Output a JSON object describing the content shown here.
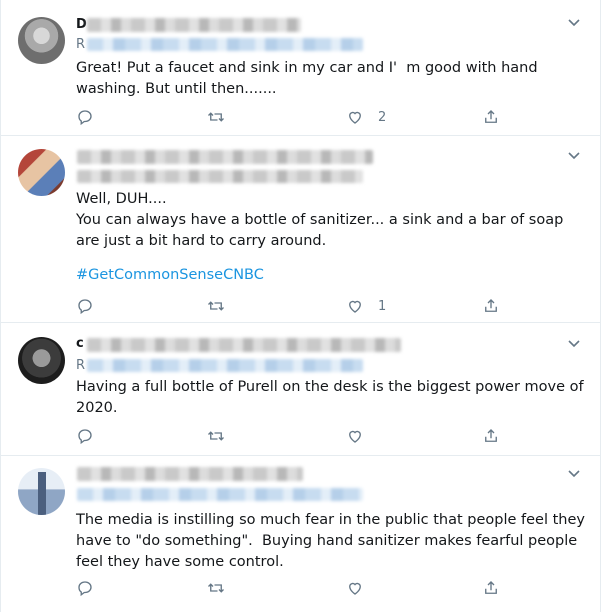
{
  "tweets": [
    {
      "avatar": "user-avatar",
      "initial_1": "D",
      "initial_2": "R",
      "text": "Great! Put a faucet and sink in my car and I'  m good with hand washing. But until then.......",
      "hashtag": "",
      "like_count": "2"
    },
    {
      "avatar": "user-avatar",
      "initial_1": "",
      "initial_2": "",
      "text": "Well, DUH....\nYou can always have a bottle of sanitizer... a sink and a bar of soap are just a bit hard to carry around.",
      "hashtag": "#GetCommonSenseCNBC",
      "like_count": "1"
    },
    {
      "avatar": "user-avatar",
      "initial_1": "c",
      "initial_2": "R",
      "text": "Having a full bottle of Purell on the desk is the biggest power move of 2020.",
      "hashtag": "",
      "like_count": ""
    },
    {
      "avatar": "user-avatar",
      "initial_1": "",
      "initial_2": "",
      "text": "The media is instilling so much fear in the public that people feel they have to \"do something\".  Buying hand sanitizer makes fearful people feel they have some control.",
      "hashtag": "",
      "like_count": ""
    }
  ],
  "icons": {
    "reply": "reply-icon",
    "retweet": "retweet-icon",
    "like": "like-icon",
    "share": "share-icon",
    "menu": "chevron-down-icon"
  },
  "colors": {
    "link": "#1b95e0",
    "muted": "#657786",
    "text": "#14171a"
  }
}
